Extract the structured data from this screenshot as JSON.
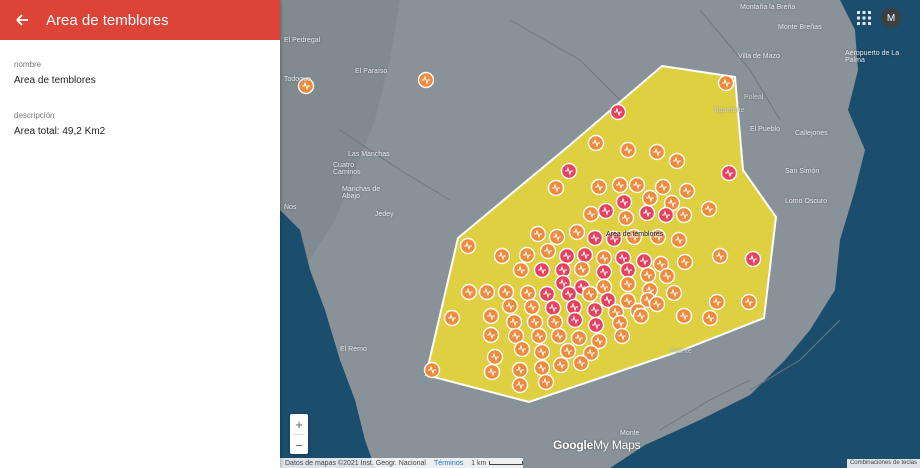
{
  "header": {
    "title": "Area de temblores"
  },
  "details": {
    "name_label": "nombre",
    "name_value": "Area de temblores",
    "description_label": "descripción",
    "description_value": "Area total: 49,2 Km2"
  },
  "map": {
    "polygon_label": "Area de temblores",
    "polygon_color": "#e5d53a",
    "marker_orange": "#f08a3c",
    "marker_red": "#e8415f",
    "places": [
      "Montaña la Breña",
      "Monte Breñas",
      "Villa de Mazo",
      "Aeropuerto de La Palma",
      "El Pedregal",
      "El Paraíso",
      "Todoque",
      "Poleal",
      "Tiguerorte",
      "El Pueblo",
      "Callejones",
      "Las Manchas",
      "Cuatro Caminos",
      "San Simón",
      "Manchas de Abajo",
      "Lomo Oscuro",
      "Jedey",
      "Nos",
      "El Remo",
      "Fuente",
      "Monte"
    ],
    "avatar_letter": "M",
    "zoom_in": "+",
    "zoom_out": "−",
    "logo": {
      "part1": "Google",
      "part2": "My Maps"
    },
    "footer": {
      "attribution": "Datos de mapas ©2021 Inst. Geogr. Nacional",
      "terms": "Términos",
      "scale": "1 km"
    },
    "shortcuts": "Combinaciones de teclas"
  }
}
